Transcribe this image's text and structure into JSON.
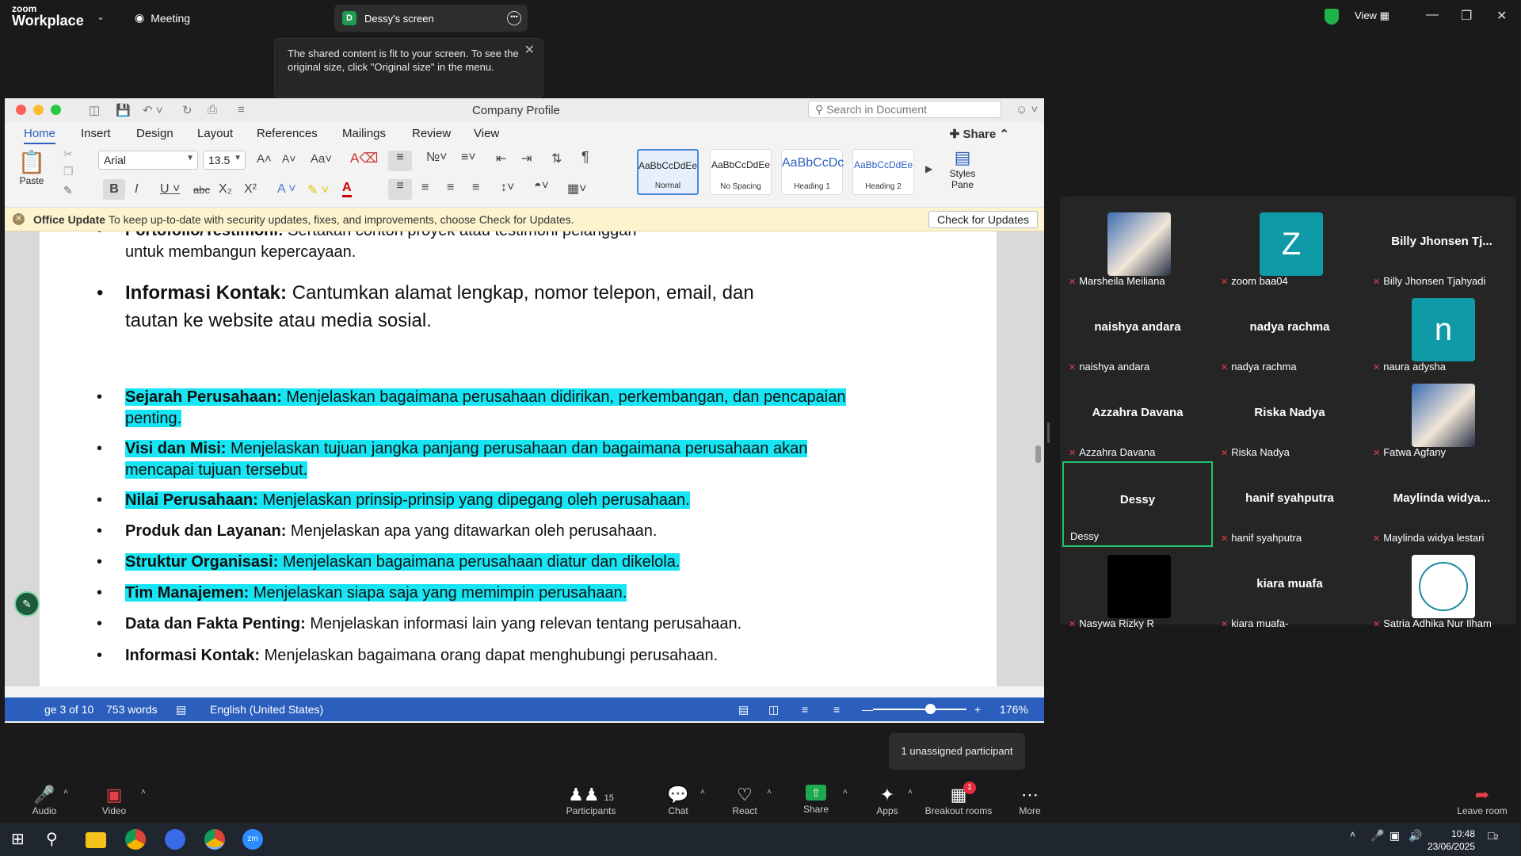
{
  "zoom": {
    "logo_line1": "zoom",
    "logo_line2": "Workplace",
    "meeting_tab": "Meeting",
    "screen_tab_badge": "D",
    "screen_tab_label": "Dessy's screen",
    "tooltip_text": "The shared content is fit to your screen. To see the original size, click \"Original size\" in the menu.",
    "view_label": "View",
    "unassigned_toast": "1 unassigned participant"
  },
  "word": {
    "doc_title": "Company Profile",
    "search_placeholder": "Search in Document",
    "tabs": [
      "Home",
      "Insert",
      "Design",
      "Layout",
      "References",
      "Mailings",
      "Review",
      "View"
    ],
    "share_label": "Share",
    "paste_label": "Paste",
    "font_name": "Arial",
    "font_size": "13.5",
    "styles": [
      {
        "preview": "AaBbCcDdEe",
        "name": "Normal"
      },
      {
        "preview": "AaBbCcDdEe",
        "name": "No Spacing"
      },
      {
        "preview": "AaBbCcDc",
        "name": "Heading 1"
      },
      {
        "preview": "AaBbCcDdEe",
        "name": "Heading 2"
      }
    ],
    "styles_pane_label": "Styles Pane",
    "office_update_title": "Office Update",
    "office_update_text": "To keep up-to-date with security updates, fixes, and improvements, choose Check for Updates.",
    "check_updates_label": "Check for Updates",
    "doc_lines": {
      "cut_top_bold": "Portofolio/Testimoni:",
      "cut_top_rest": " Sertakan contoh proyek atau testimoni pelanggan",
      "cut_top_line2": "untuk membangun kepercayaan.",
      "kontak1_bold": "Informasi Kontak:",
      "kontak1_rest": " Cantumkan alamat lengkap, nomor telepon, email, dan",
      "kontak1_line2": "tautan ke website atau media sosial.",
      "sejarah_bold": "Sejarah Perusahaan:",
      "sejarah_rest": " Menjelaskan bagaimana perusahaan didirikan, perkembangan, dan pencapaian",
      "sejarah_line2": "penting.",
      "visi_bold": "Visi dan Misi:",
      "visi_rest": " Menjelaskan tujuan jangka panjang perusahaan dan bagaimana perusahaan akan",
      "visi_line2": "mencapai tujuan tersebut.",
      "nilai_bold": "Nilai Perusahaan:",
      "nilai_rest": " Menjelaskan prinsip-prinsip yang dipegang oleh perusahaan.",
      "produk_bold": "Produk dan Layanan:",
      "produk_rest": " Menjelaskan apa yang ditawarkan oleh perusahaan.",
      "struktur_bold": "Struktur Organisasi:",
      "struktur_rest": " Menjelaskan bagaimana perusahaan diatur dan dikelola.",
      "tim_bold": "Tim Manajemen:",
      "tim_rest": " Menjelaskan siapa saja yang memimpin perusahaan.",
      "data_bold": "Data dan Fakta Penting:",
      "data_rest": " Menjelaskan informasi lain yang relevan tentang perusahaan.",
      "kontak2_bold": "Informasi Kontak:",
      "kontak2_rest": " Menjelaskan bagaimana orang dapat menghubungi perusahaan."
    },
    "status": {
      "page": "ge 3 of 10",
      "words": "753 words",
      "language": "English (United States)",
      "zoom": "176%"
    }
  },
  "participants": [
    {
      "display": "",
      "label": "Marsheila Meiliana",
      "avatar": "photo",
      "muted": true
    },
    {
      "display": "Z",
      "label": "zoom baa04",
      "avatar": "letter",
      "muted": true
    },
    {
      "display": "Billy Jhonsen Tj...",
      "label": "Billy Jhonsen Tjahyadi",
      "avatar": "none",
      "muted": true
    },
    {
      "display": "naishya andara",
      "label": "naishya andara",
      "avatar": "none",
      "muted": true
    },
    {
      "display": "nadya rachma",
      "label": "nadya rachma",
      "avatar": "none",
      "muted": true
    },
    {
      "display": "n",
      "label": "naura adysha",
      "avatar": "letter",
      "muted": true
    },
    {
      "display": "Azzahra Davana",
      "label": "Azzahra Davana",
      "avatar": "none",
      "muted": true
    },
    {
      "display": "Riska Nadya",
      "label": "Riska Nadya",
      "avatar": "none",
      "muted": true
    },
    {
      "display": "",
      "label": "Fatwa Agfany",
      "avatar": "photo",
      "muted": true
    },
    {
      "display": "Dessy",
      "label": "Dessy",
      "avatar": "none",
      "muted": false
    },
    {
      "display": "hanif syahputra",
      "label": "hanif syahputra",
      "avatar": "none",
      "muted": true
    },
    {
      "display": "Maylinda  widya...",
      "label": "Maylinda widya lestari",
      "avatar": "none",
      "muted": true
    },
    {
      "display": "",
      "label": "Nasywa Rizky R",
      "avatar": "black",
      "muted": true
    },
    {
      "display": "kiara muafa",
      "label": "kiara muafa-",
      "avatar": "none",
      "muted": true
    },
    {
      "display": "",
      "label": "Satria Adhika Nur Ilham",
      "avatar": "logo",
      "muted": true
    }
  ],
  "toolbar": {
    "audio": "Audio",
    "video": "Video",
    "participants": "Participants",
    "participants_count": "15",
    "chat": "Chat",
    "react": "React",
    "share": "Share",
    "apps": "Apps",
    "breakout": "Breakout rooms",
    "breakout_badge": "1",
    "more": "More",
    "leave": "Leave room"
  },
  "taskbar": {
    "time": "10:48",
    "date": "23/06/2025",
    "notif_count": "2"
  },
  "colors": {
    "highlight": "#17e5f3",
    "word_blue": "#2c5fbd",
    "zoom_share_green": "#1ea84f",
    "active_speaker": "#21c36b"
  }
}
